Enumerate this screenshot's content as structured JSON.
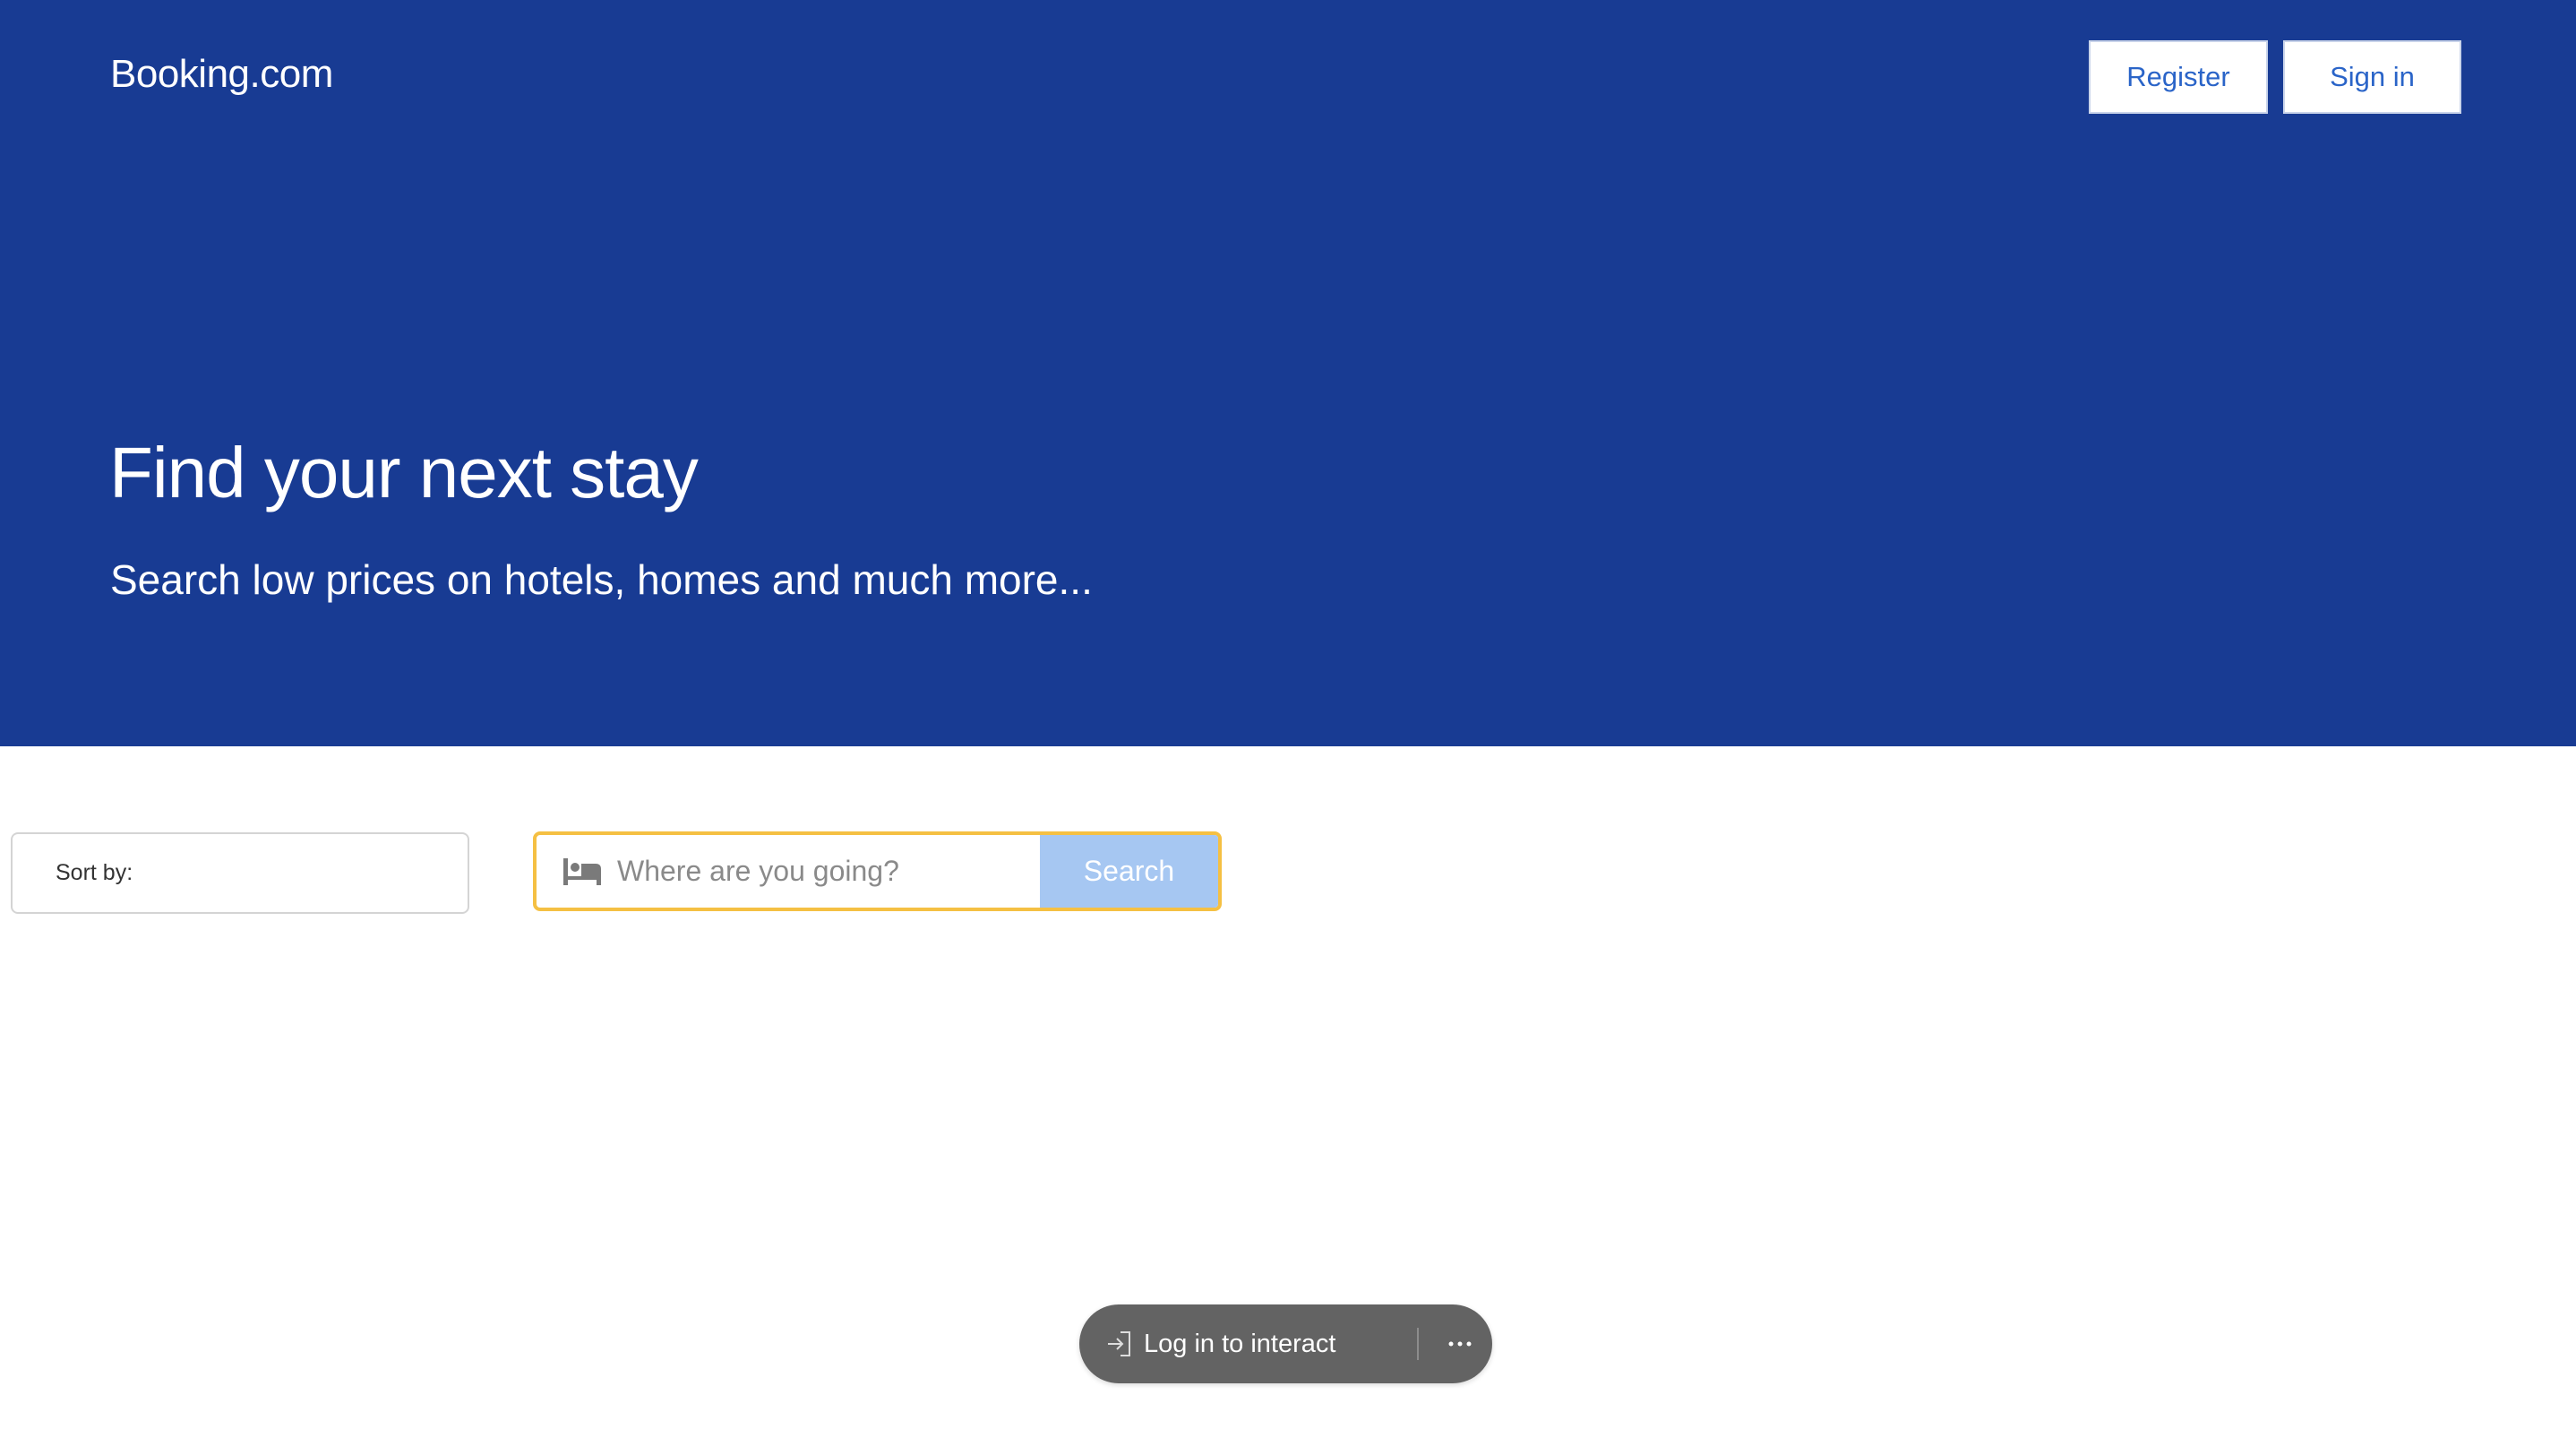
{
  "header": {
    "logo": "Booking.com",
    "register_label": "Register",
    "signin_label": "Sign in"
  },
  "hero": {
    "title": "Find your next stay",
    "subtitle": "Search low prices on hotels, homes and much more..."
  },
  "sort": {
    "label": "Sort by:"
  },
  "search": {
    "icon": "bed-icon",
    "placeholder": "Where are you going?",
    "value": "",
    "button_label": "Search"
  },
  "overlay": {
    "login_icon": "login-arrow-icon",
    "login_label": "Log in to interact",
    "more_icon": "more-horizontal-icon"
  },
  "colors": {
    "brand_blue": "#183b93",
    "link_blue": "#2a64c8",
    "search_border": "#f5c043",
    "search_button": "#a6c7f2",
    "pill_bg": "#636363"
  }
}
